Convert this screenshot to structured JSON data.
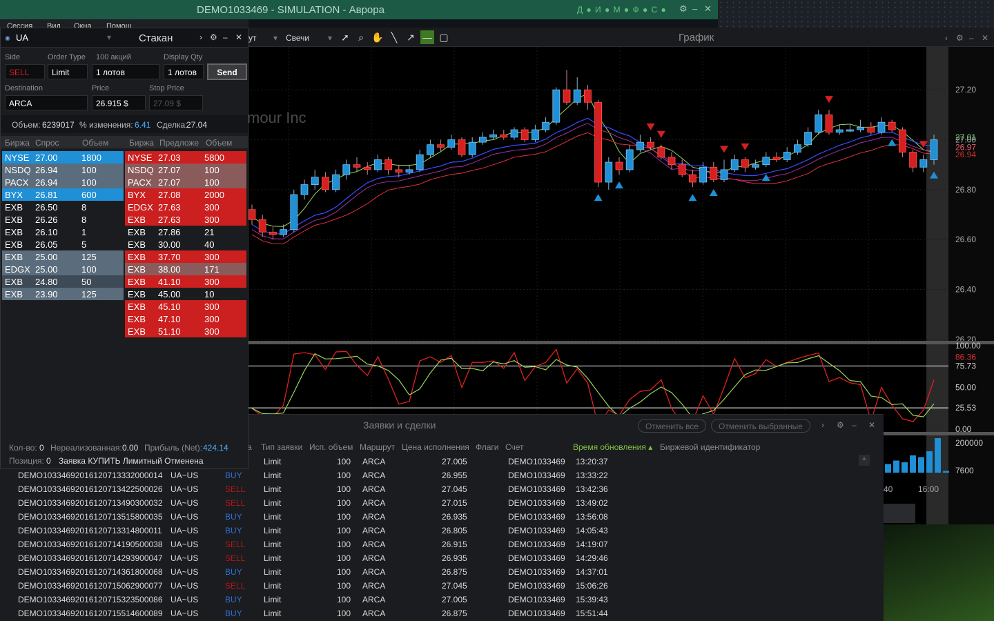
{
  "window": {
    "title": "DEMO1033469 - SIMULATION - Аврора",
    "indicators": "Д ● И ● М ● Ф ● С ●"
  },
  "menu": [
    "Сессия",
    "Вид",
    "Окна",
    "Помощ"
  ],
  "chart": {
    "title": "График",
    "interval_label": "ут",
    "style_label": "Свечи",
    "watermark": "mour Inc",
    "price_ticks": [
      "27.20",
      "27.00",
      "26.80",
      "26.60",
      "26.40",
      "26.20"
    ],
    "price_marks": [
      {
        "v": "27.01",
        "c": "#7fc87f"
      },
      {
        "v": "26.97",
        "c": "#e06070"
      },
      {
        "v": "26.94",
        "c": "#d03030"
      }
    ],
    "stoch_ticks": [
      "100.00",
      "75.73",
      "50.00",
      "25.53",
      "0.00"
    ],
    "stoch_mark": "86.36",
    "volume_ticks": [
      "200000",
      "7600"
    ],
    "time_ticks": [
      "40",
      "16:00"
    ],
    "colors": {
      "up": "#1f8fd6",
      "down": "#d42020",
      "ma_green": "#9ad45a",
      "ma_blue": "#3a4cff",
      "ma_red": "#e03040"
    },
    "candles": [
      [
        26.72,
        26.68,
        26.74,
        26.66
      ],
      [
        26.68,
        26.63,
        26.7,
        26.61
      ],
      [
        26.63,
        26.62,
        26.65,
        26.6
      ],
      [
        26.62,
        26.64,
        26.66,
        26.61
      ],
      [
        26.64,
        26.78,
        26.8,
        26.63
      ],
      [
        26.78,
        26.82,
        26.84,
        26.76
      ],
      [
        26.82,
        26.85,
        26.88,
        26.8
      ],
      [
        26.85,
        26.8,
        26.87,
        26.79
      ],
      [
        26.8,
        26.86,
        26.88,
        26.79
      ],
      [
        26.86,
        26.9,
        26.92,
        26.84
      ],
      [
        26.9,
        26.89,
        26.93,
        26.87
      ],
      [
        26.89,
        26.88,
        26.91,
        26.86
      ],
      [
        26.88,
        26.92,
        26.94,
        26.87
      ],
      [
        26.92,
        26.88,
        26.93,
        26.86
      ],
      [
        26.88,
        26.87,
        26.9,
        26.85
      ],
      [
        26.87,
        26.88,
        26.9,
        26.86
      ],
      [
        26.88,
        26.94,
        26.96,
        26.87
      ],
      [
        26.94,
        26.98,
        27.0,
        26.93
      ],
      [
        26.98,
        26.97,
        27.0,
        26.95
      ],
      [
        26.97,
        27.0,
        27.02,
        26.96
      ],
      [
        27.0,
        26.94,
        27.01,
        26.93
      ],
      [
        26.94,
        26.99,
        27.01,
        26.93
      ],
      [
        26.99,
        27.01,
        27.03,
        26.98
      ],
      [
        27.01,
        27.02,
        27.04,
        27.0
      ],
      [
        27.02,
        27.01,
        27.04,
        27.0
      ],
      [
        27.01,
        27.04,
        27.05,
        27.0
      ],
      [
        27.04,
        27.0,
        27.05,
        26.99
      ],
      [
        27.0,
        27.04,
        27.06,
        26.99
      ],
      [
        27.04,
        27.07,
        27.09,
        27.03
      ],
      [
        27.07,
        27.2,
        27.21,
        27.06
      ],
      [
        27.2,
        27.15,
        27.28,
        27.14
      ],
      [
        27.15,
        27.2,
        27.25,
        27.14
      ],
      [
        27.2,
        27.15,
        27.22,
        27.12
      ],
      [
        27.15,
        26.83,
        27.16,
        26.81
      ],
      [
        26.83,
        26.91,
        26.93,
        26.8
      ],
      [
        26.91,
        26.88,
        26.93,
        26.86
      ],
      [
        26.88,
        26.96,
        26.98,
        26.87
      ],
      [
        26.96,
        26.99,
        27.02,
        26.95
      ],
      [
        26.99,
        26.97,
        27.01,
        26.96
      ],
      [
        26.97,
        26.93,
        26.98,
        26.92
      ],
      [
        26.93,
        26.9,
        26.95,
        26.88
      ],
      [
        26.9,
        26.86,
        26.92,
        26.85
      ],
      [
        26.86,
        26.83,
        26.88,
        26.81
      ],
      [
        26.83,
        26.89,
        26.91,
        26.82
      ],
      [
        26.89,
        26.84,
        26.91,
        26.83
      ],
      [
        26.84,
        26.88,
        26.92,
        26.83
      ],
      [
        26.88,
        26.92,
        26.94,
        26.87
      ],
      [
        26.92,
        26.89,
        26.93,
        26.87
      ],
      [
        26.89,
        26.9,
        26.92,
        26.88
      ],
      [
        26.9,
        26.93,
        26.95,
        26.89
      ],
      [
        26.93,
        26.92,
        26.95,
        26.91
      ],
      [
        26.92,
        26.95,
        26.97,
        26.91
      ],
      [
        26.95,
        26.98,
        27.0,
        26.94
      ],
      [
        26.98,
        27.03,
        27.05,
        26.97
      ],
      [
        27.03,
        27.1,
        27.12,
        27.02
      ],
      [
        27.1,
        27.03,
        27.12,
        27.02
      ],
      [
        27.03,
        27.04,
        27.06,
        27.02
      ],
      [
        27.04,
        27.04,
        27.06,
        27.03
      ],
      [
        27.04,
        27.05,
        27.08,
        27.03
      ],
      [
        27.05,
        27.03,
        27.07,
        27.02
      ],
      [
        27.03,
        27.07,
        27.09,
        27.02
      ],
      [
        27.07,
        27.04,
        27.08,
        27.03
      ],
      [
        27.04,
        26.95,
        27.05,
        26.93
      ],
      [
        26.95,
        26.89,
        26.96,
        26.87
      ],
      [
        26.89,
        26.92,
        26.94,
        26.87
      ],
      [
        26.92,
        27.0,
        27.02,
        26.9
      ]
    ],
    "up_arrows": [
      33,
      35,
      42,
      44,
      49,
      61,
      65
    ],
    "down_arrows": [
      38,
      39,
      45,
      47,
      55,
      64
    ]
  },
  "book": {
    "symbol": "UA",
    "title": "Стакан",
    "labels": {
      "side": "Side",
      "order_type": "Order Type",
      "shares": "100 акций",
      "display_qty": "Display Qty",
      "destination": "Destination",
      "price": "Price",
      "stop_price": "Stop Price"
    },
    "side": "SELL",
    "order_type": "Limit",
    "qty": "1 лотов",
    "display_qty": "1 лотов",
    "send": "Send",
    "destination": "ARCA",
    "price": "26.915 $",
    "stop_price": "27.09 $",
    "stats": {
      "volume_label": "Объем:",
      "volume": "6239017",
      "change_label": "% изменения:",
      "change": "6.41",
      "trade_label": "Сделка:",
      "trade": "27.04"
    },
    "bid_headers": [
      "Биржа",
      "Спрос",
      "Объем"
    ],
    "ask_headers": [
      "Биржа",
      "Предложе",
      "Объем"
    ],
    "bids": [
      {
        "ex": "NYSE",
        "p": "27.00",
        "q": "1800",
        "bg": "#1f8fd6"
      },
      {
        "ex": "NSDQ",
        "p": "26.94",
        "q": "100",
        "bg": "#5b6d7c"
      },
      {
        "ex": "PACX",
        "p": "26.94",
        "q": "100",
        "bg": "#5b6d7c"
      },
      {
        "ex": "BYX",
        "p": "26.81",
        "q": "600",
        "bg": "#1f8fd6"
      },
      {
        "ex": "EXB",
        "p": "26.50",
        "q": "8",
        "bg": "#1b1c1f"
      },
      {
        "ex": "EXB",
        "p": "26.26",
        "q": "8",
        "bg": "#1b1c1f"
      },
      {
        "ex": "EXB",
        "p": "26.10",
        "q": "1",
        "bg": "#1b1c1f"
      },
      {
        "ex": "EXB",
        "p": "26.05",
        "q": "5",
        "bg": "#1b1c1f"
      },
      {
        "ex": "EXB",
        "p": "25.00",
        "q": "125",
        "bg": "#5b6d7c"
      },
      {
        "ex": "EDGX",
        "p": "25.00",
        "q": "100",
        "bg": "#5b6d7c"
      },
      {
        "ex": "EXB",
        "p": "24.80",
        "q": "50",
        "bg": "#3e4a55"
      },
      {
        "ex": "EXB",
        "p": "23.90",
        "q": "125",
        "bg": "#5b6d7c"
      }
    ],
    "asks": [
      {
        "ex": "NYSE",
        "p": "27.03",
        "q": "5800",
        "bg": "#cc1f1f"
      },
      {
        "ex": "NSDQ",
        "p": "27.07",
        "q": "100",
        "bg": "#8a5b5b"
      },
      {
        "ex": "PACX",
        "p": "27.07",
        "q": "100",
        "bg": "#8a5b5b"
      },
      {
        "ex": "BYX",
        "p": "27.08",
        "q": "2000",
        "bg": "#cc1f1f"
      },
      {
        "ex": "EDGX",
        "p": "27.63",
        "q": "300",
        "bg": "#cc1f1f"
      },
      {
        "ex": "EXB",
        "p": "27.63",
        "q": "300",
        "bg": "#cc1f1f"
      },
      {
        "ex": "EXB",
        "p": "27.86",
        "q": "21",
        "bg": "#1b1c1f"
      },
      {
        "ex": "EXB",
        "p": "30.00",
        "q": "40",
        "bg": "#1b1c1f"
      },
      {
        "ex": "EXB",
        "p": "37.70",
        "q": "300",
        "bg": "#cc1f1f"
      },
      {
        "ex": "EXB",
        "p": "38.00",
        "q": "171",
        "bg": "#8a5b5b"
      },
      {
        "ex": "EXB",
        "p": "41.10",
        "q": "300",
        "bg": "#cc1f1f"
      },
      {
        "ex": "EXB",
        "p": "45.00",
        "q": "10",
        "bg": "#1b1c1f"
      },
      {
        "ex": "EXB",
        "p": "45.10",
        "q": "300",
        "bg": "#cc1f1f"
      },
      {
        "ex": "EXB",
        "p": "47.10",
        "q": "300",
        "bg": "#cc1f1f"
      },
      {
        "ex": "EXB",
        "p": "51.10",
        "q": "300",
        "bg": "#cc1f1f"
      }
    ],
    "footer": {
      "qty_label": "Кол-во:",
      "qty": "0",
      "unreal_label": "Нереализованная:",
      "unreal": "0.00",
      "profit_label": "Прибыль (Net):",
      "profit": "424.14",
      "pos_label": "Позиция:",
      "pos": "0",
      "status": "Заявка КУПИТЬ Лимитный Отменена"
    }
  },
  "orders": {
    "title": "Заявки и сделки",
    "cancel_all": "Отменить все",
    "cancel_selected": "Отменить выбранные",
    "headers": [
      "а",
      "Тип заявки",
      "Исп. объем",
      "Маршрут",
      "Цена исполнения",
      "Флаги",
      "Счет",
      "Время обновления ▴",
      "Биржевой идентификатор"
    ],
    "rows": [
      {
        "id": "",
        "sym": "",
        "side": "",
        "type": "Limit",
        "vol": "100",
        "route": "ARCA",
        "price": "27.005",
        "acct": "DEMO1033469",
        "time": "13:20:37"
      },
      {
        "id": "DEMO10334692016120713332000014",
        "sym": "UA~US",
        "side": "BUY",
        "type": "Limit",
        "vol": "100",
        "route": "ARCA",
        "price": "26.955",
        "acct": "DEMO1033469",
        "time": "13:33:22"
      },
      {
        "id": "DEMO10334692016120713422500026",
        "sym": "UA~US",
        "side": "SELL",
        "type": "Limit",
        "vol": "100",
        "route": "ARCA",
        "price": "27.045",
        "acct": "DEMO1033469",
        "time": "13:42:36"
      },
      {
        "id": "DEMO10334692016120713490300032",
        "sym": "UA~US",
        "side": "SELL",
        "type": "Limit",
        "vol": "100",
        "route": "ARCA",
        "price": "27.015",
        "acct": "DEMO1033469",
        "time": "13:49:02"
      },
      {
        "id": "DEMO10334692016120713515800035",
        "sym": "UA~US",
        "side": "BUY",
        "type": "Limit",
        "vol": "100",
        "route": "ARCA",
        "price": "26.935",
        "acct": "DEMO1033469",
        "time": "13:56:08"
      },
      {
        "id": "DEMO10334692016120713314800011",
        "sym": "UA~US",
        "side": "BUY",
        "type": "Limit",
        "vol": "100",
        "route": "ARCA",
        "price": "26.805",
        "acct": "DEMO1033469",
        "time": "14:05:43"
      },
      {
        "id": "DEMO10334692016120714190500038",
        "sym": "UA~US",
        "side": "SELL",
        "type": "Limit",
        "vol": "100",
        "route": "ARCA",
        "price": "26.915",
        "acct": "DEMO1033469",
        "time": "14:19:07"
      },
      {
        "id": "DEMO10334692016120714293900047",
        "sym": "UA~US",
        "side": "SELL",
        "type": "Limit",
        "vol": "100",
        "route": "ARCA",
        "price": "26.935",
        "acct": "DEMO1033469",
        "time": "14:29:46"
      },
      {
        "id": "DEMO10334692016120714361800068",
        "sym": "UA~US",
        "side": "BUY",
        "type": "Limit",
        "vol": "100",
        "route": "ARCA",
        "price": "26.875",
        "acct": "DEMO1033469",
        "time": "14:37:01"
      },
      {
        "id": "DEMO10334692016120715062900077",
        "sym": "UA~US",
        "side": "SELL",
        "type": "Limit",
        "vol": "100",
        "route": "ARCA",
        "price": "27.045",
        "acct": "DEMO1033469",
        "time": "15:06:26"
      },
      {
        "id": "DEMO10334692016120715323500086",
        "sym": "UA~US",
        "side": "BUY",
        "type": "Limit",
        "vol": "100",
        "route": "ARCA",
        "price": "27.005",
        "acct": "DEMO1033469",
        "time": "15:39:43"
      },
      {
        "id": "DEMO10334692016120715514600089",
        "sym": "UA~US",
        "side": "BUY",
        "type": "Limit",
        "vol": "100",
        "route": "ARCA",
        "price": "26.875",
        "acct": "DEMO1033469",
        "time": "15:51:44"
      }
    ]
  }
}
